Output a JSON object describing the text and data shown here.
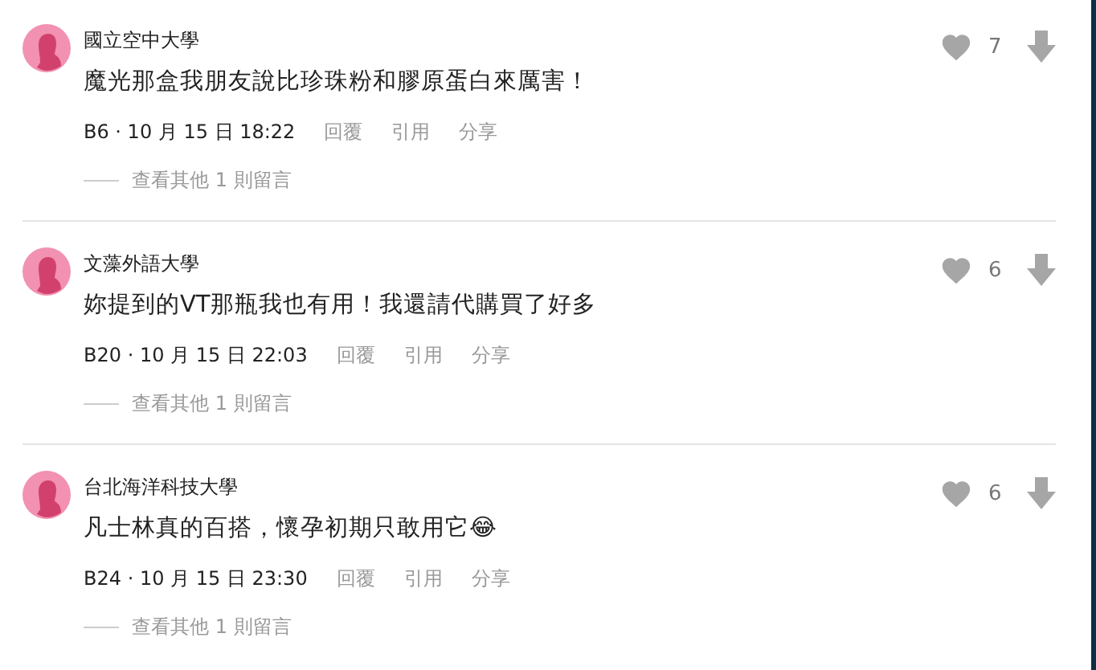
{
  "comments": [
    {
      "author": "國立空中大學",
      "text": "魔光那盒我朋友說比珍珠粉和膠原蛋白來厲害！",
      "meta": "B6 · 10 月 15 日 18:22",
      "actions": [
        "回覆",
        "引用",
        "分享"
      ],
      "likes": "7",
      "replies": "查看其他 1 則留言"
    },
    {
      "author": "文藻外語大學",
      "text": "妳提到的VT那瓶我也有用！我還請代購買了好多",
      "meta": "B20 · 10 月 15 日 22:03",
      "actions": [
        "回覆",
        "引用",
        "分享"
      ],
      "likes": "6",
      "replies": "查看其他 1 則留言"
    },
    {
      "author": "台北海洋科技大學",
      "text": "凡士林真的百搭，懷孕初期只敢用它😂",
      "meta": "B24 · 10 月 15 日 23:30",
      "actions": [
        "回覆",
        "引用",
        "分享"
      ],
      "likes": "6",
      "replies": "查看其他 1 則留言"
    }
  ]
}
